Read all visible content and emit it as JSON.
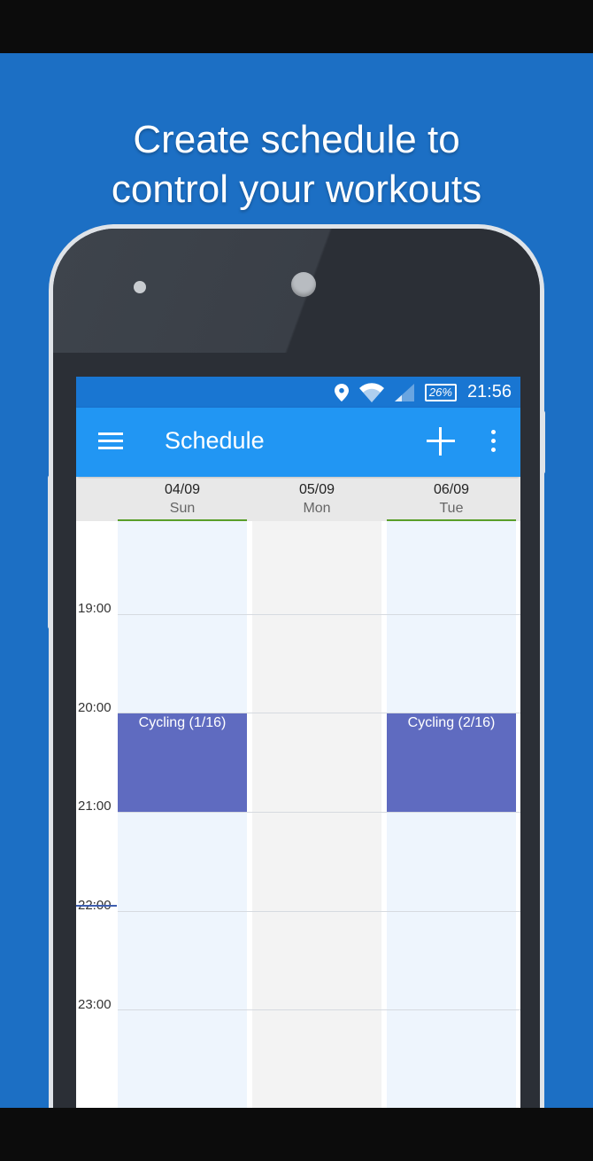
{
  "headline": {
    "line1": "Create schedule to",
    "line2": "control your workouts"
  },
  "colors": {
    "promo_background": "#1c6fc4",
    "statusbar": "#1976d2",
    "appbar": "#2196f3",
    "event": "#5f6bc0",
    "today_indicator": "#5a9e2a"
  },
  "statusbar": {
    "battery": "26%",
    "time": "21:56",
    "icons": [
      "location-icon",
      "wifi-icon",
      "signal-icon",
      "battery-icon"
    ]
  },
  "appbar": {
    "title": "Schedule",
    "icons": [
      "menu-icon",
      "add-icon",
      "more-vert-icon"
    ]
  },
  "days": [
    {
      "date": "04/09",
      "dow": "Sun",
      "today": true
    },
    {
      "date": "05/09",
      "dow": "Mon",
      "today": false
    },
    {
      "date": "06/09",
      "dow": "Tue",
      "today": true
    }
  ],
  "time_labels": [
    "19:00",
    "20:00",
    "21:00",
    "22:00",
    "23:00"
  ],
  "current_time_marker": "22:00",
  "events": [
    {
      "label": "Cycling (1/16)",
      "day": "04/09",
      "start": "20:00",
      "end": "21:00"
    },
    {
      "label": "Cycling (2/16)",
      "day": "06/09",
      "start": "20:00",
      "end": "21:00"
    }
  ]
}
